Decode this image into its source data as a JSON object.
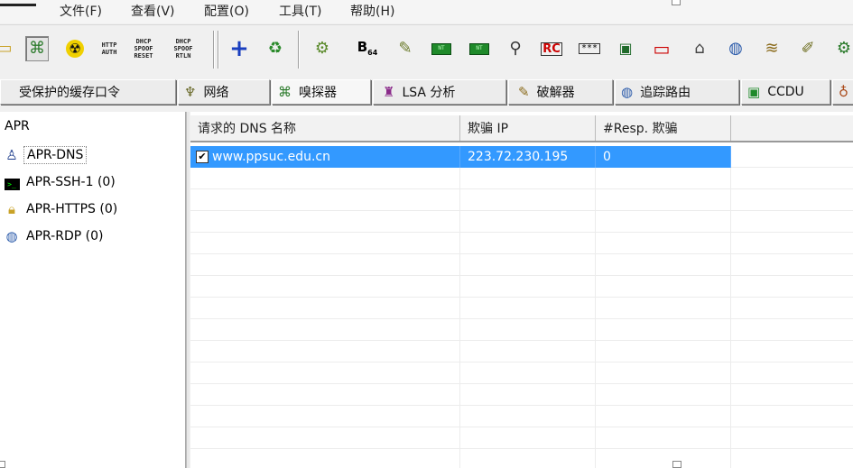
{
  "menu": {
    "items": [
      "文件(F)",
      "查看(V)",
      "配置(O)",
      "工具(T)",
      "帮助(H)"
    ]
  },
  "toolbar": {
    "btn_txt_1": "HTTP\nAUTH",
    "btn_txt_2": "DHCP\nSPOOF\nRESET",
    "btn_txt_3": "DHCP\nSPOOF\nRTLN",
    "green_1": "NT",
    "green_2": "NT",
    "dots": "***"
  },
  "tabs": [
    {
      "label": "受保护的缓存口令",
      "icon": ""
    },
    {
      "label": "网络",
      "icon": "network-icon"
    },
    {
      "label": "嗅探器",
      "icon": "sniffer-icon"
    },
    {
      "label": "LSA 分析",
      "icon": "lsa-icon"
    },
    {
      "label": "破解器",
      "icon": "cracker-icon"
    },
    {
      "label": "追踪路由",
      "icon": "traceroute-icon"
    },
    {
      "label": "CCDU",
      "icon": "ccdu-icon"
    }
  ],
  "tree": {
    "root": "APR",
    "items": [
      {
        "label": "APR-DNS",
        "icon": "user-network-icon"
      },
      {
        "label": "APR-SSH-1 (0)",
        "icon": "terminal-icon"
      },
      {
        "label": "APR-HTTPS (0)",
        "icon": "lock-icon"
      },
      {
        "label": "APR-RDP (0)",
        "icon": "remote-desktop-icon"
      }
    ]
  },
  "grid": {
    "columns": [
      "请求的 DNS 名称",
      "欺骗 IP",
      "#Resp. 欺骗"
    ],
    "rows": [
      {
        "checked": true,
        "dns": "www.ppsuc.edu.cn",
        "ip": "223.72.230.195",
        "resp": "0"
      }
    ]
  },
  "colors": {
    "selection": "#3399ff"
  }
}
